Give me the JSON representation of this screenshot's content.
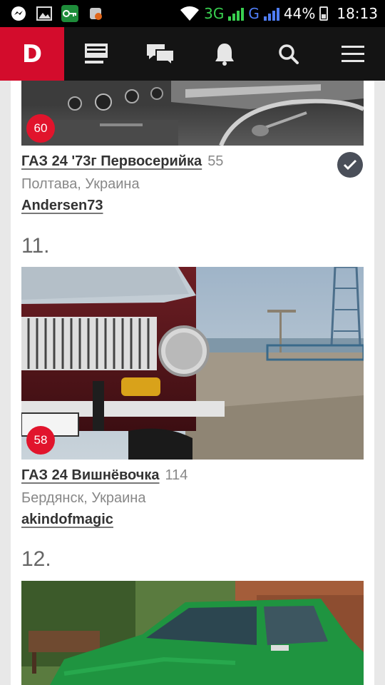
{
  "status_bar": {
    "network_3g": "3G",
    "network_g": "G",
    "battery": "44%",
    "time": "18:13"
  },
  "nav": {
    "logo": "D"
  },
  "entries": [
    {
      "rank_badge": "60",
      "title": "ГАЗ 24 '73г Первосерийка",
      "count": "55",
      "location": "Полтава, Украина",
      "author": "Andersen73",
      "verified": true
    },
    {
      "section_number": "11.",
      "rank_badge": "58",
      "title": "ГАЗ 24 Вишнёвочка",
      "count": "114",
      "location": "Бердянск, Украина",
      "author": "akindofmagic"
    },
    {
      "section_number": "12."
    }
  ]
}
